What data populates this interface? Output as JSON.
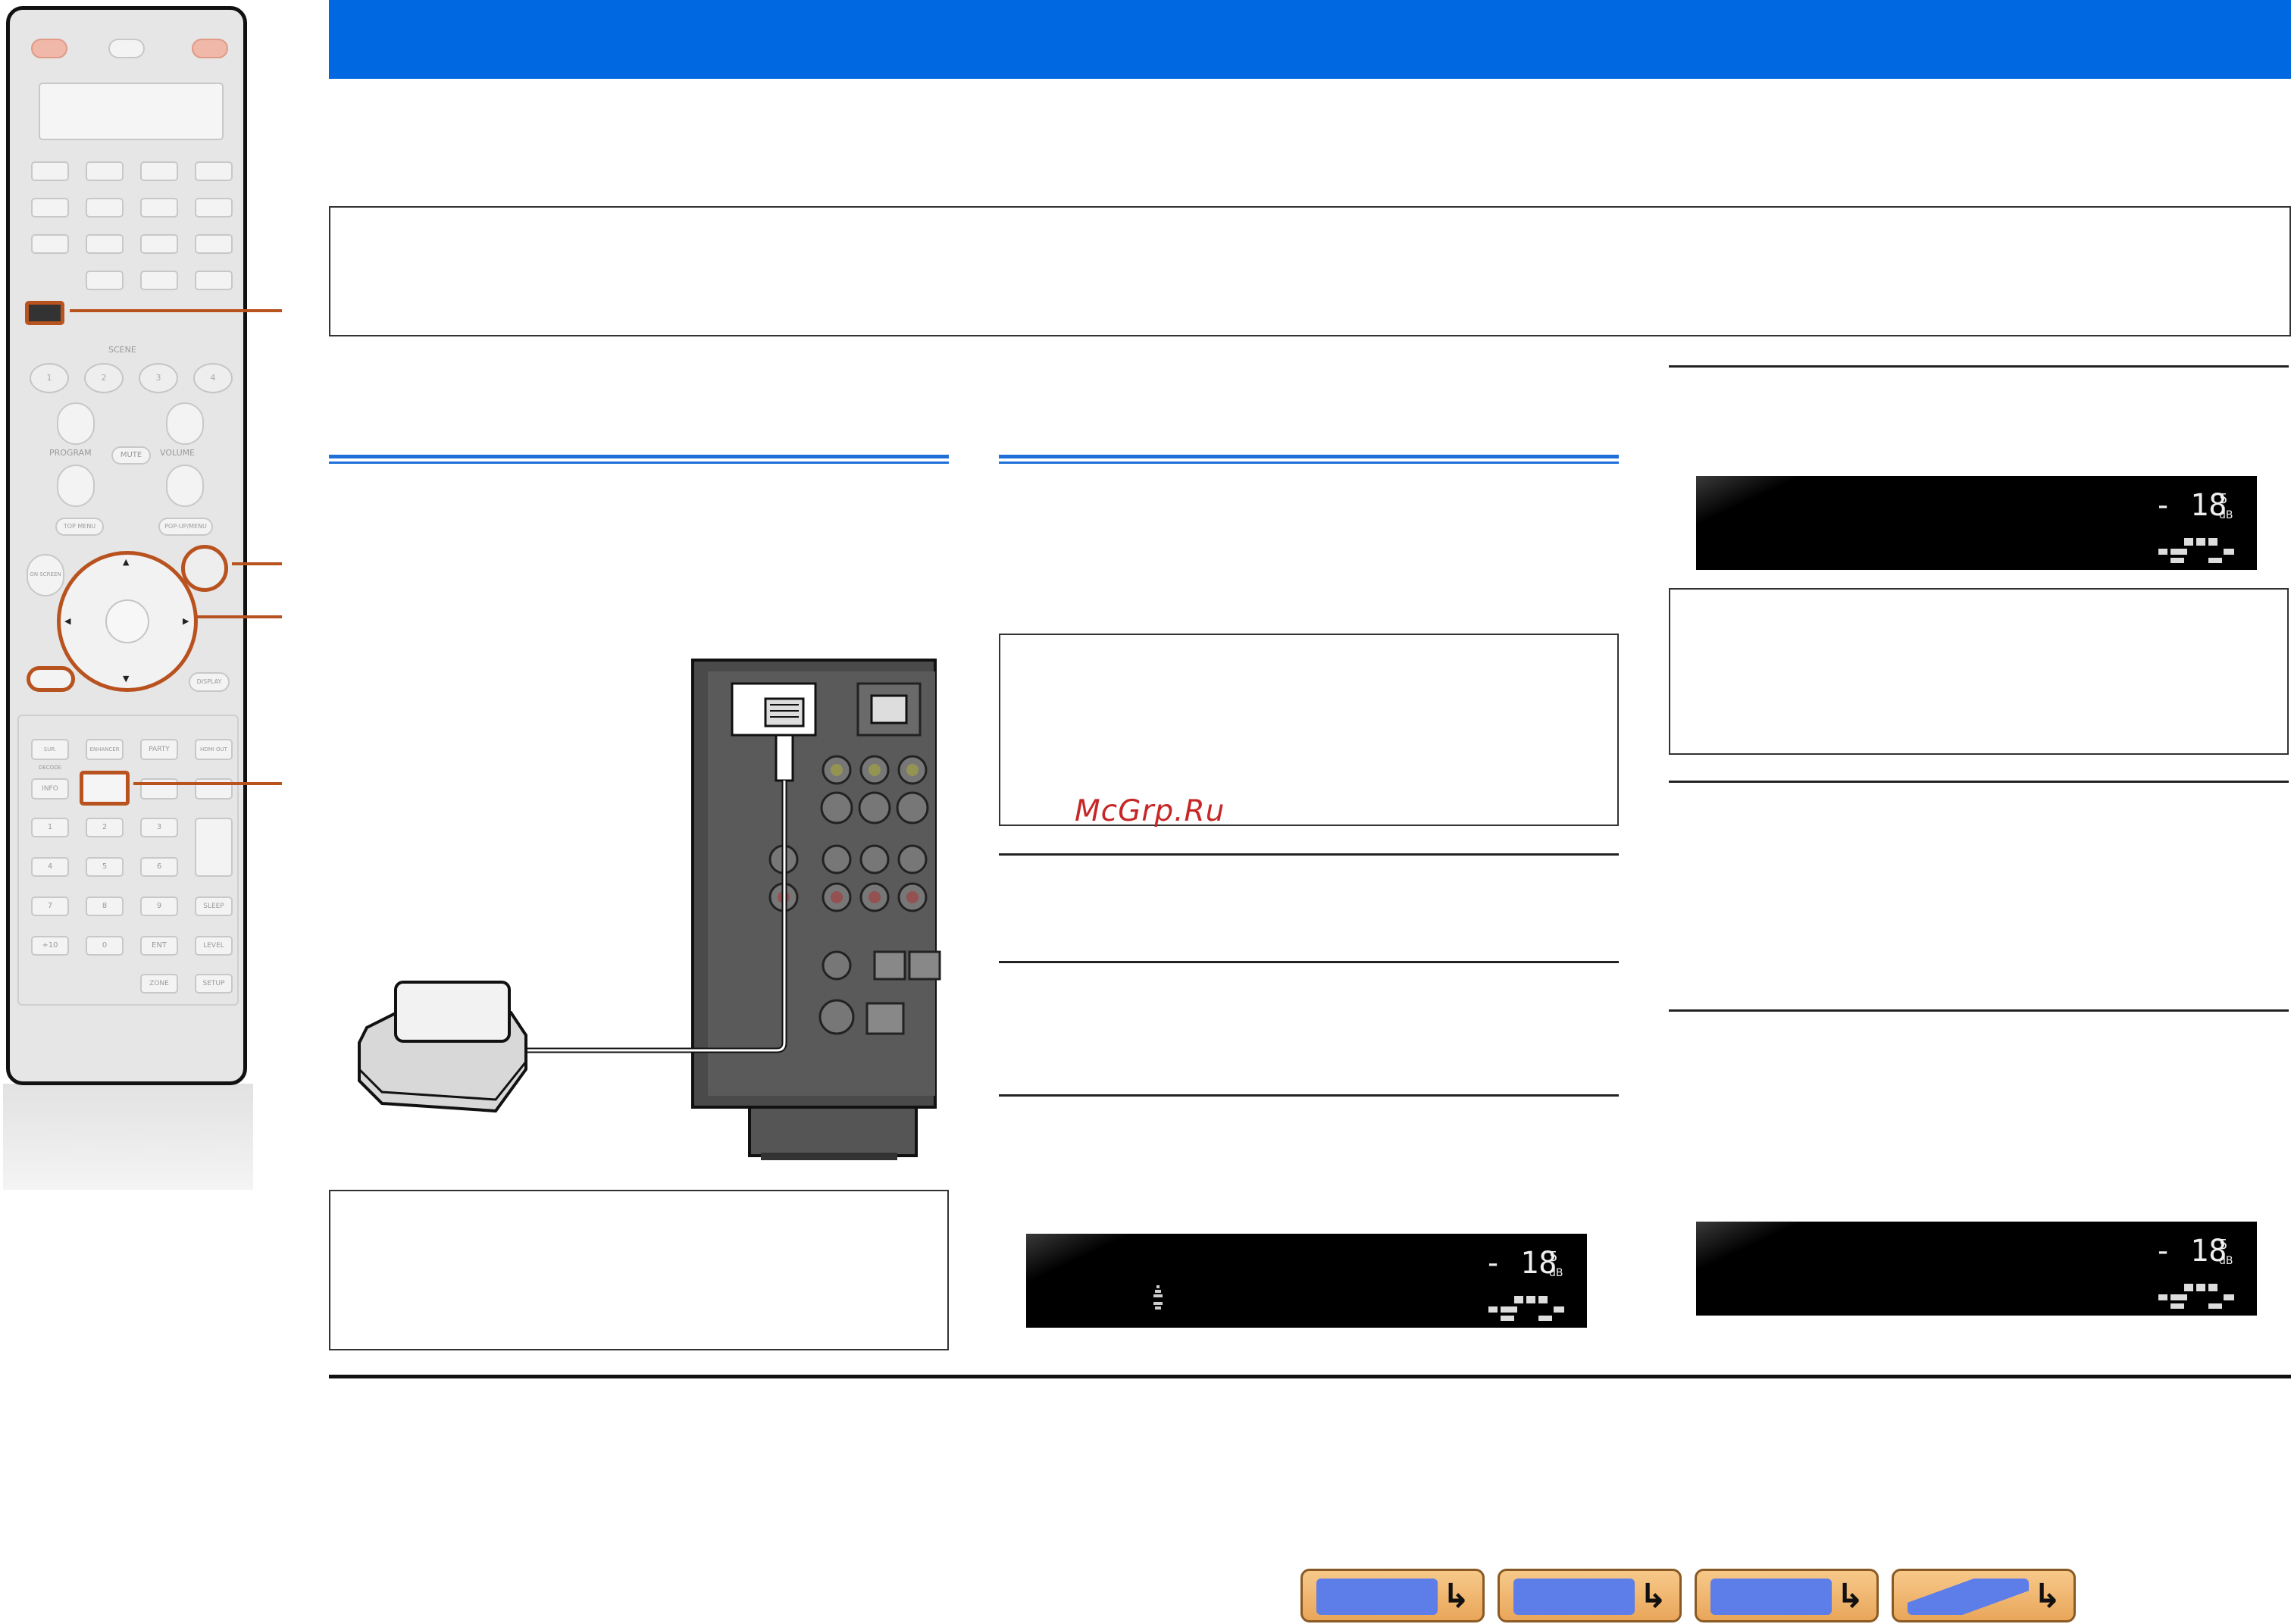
{
  "watermark": "McGrp.Ru",
  "lcd_level": "- 18.5",
  "lcd_unit": "dB",
  "lcd_channels": [
    "L",
    "C",
    "R"
  ],
  "remote": {
    "scene_label": "SCENE",
    "program_label": "PROGRAM",
    "volume_label": "VOLUME",
    "mute_label": "MUTE",
    "top_menu_label": "TOP MENU",
    "popup_menu_label": "POP-UP/MENU",
    "on_screen_label": "ON SCREEN",
    "display_label": "DISPLAY",
    "mode_keys": [
      "SUR. DECODE",
      "ENHANCER",
      "PARTY",
      "HDMI OUT"
    ],
    "info_label": "INFO",
    "num_keys": [
      "1",
      "2",
      "3",
      "4",
      "5",
      "6",
      "7",
      "8",
      "9",
      "+10",
      "0",
      "ENT"
    ],
    "sleep_label": "SLEEP",
    "level_label": "LEVEL",
    "zone_label": "ZONE",
    "setup_label": "SETUP",
    "scene_keys": [
      "1",
      "2",
      "3",
      "4"
    ]
  },
  "nav_buttons": [
    {
      "name": "front-panel"
    },
    {
      "name": "rear-panel"
    },
    {
      "name": "front-display"
    },
    {
      "name": "remote-control"
    }
  ],
  "colors": {
    "header": "#0068e0",
    "callout": "#b8521f",
    "section_rule": "#1e6fd8"
  }
}
